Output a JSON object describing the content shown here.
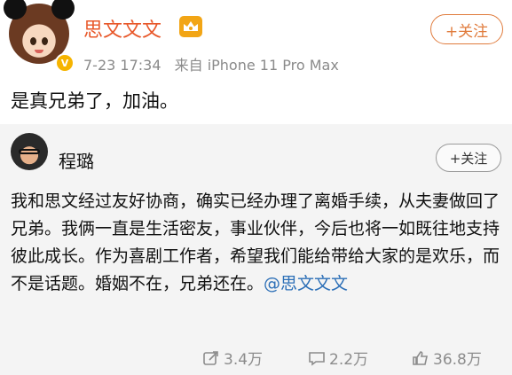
{
  "post": {
    "author": "思文文文",
    "timestamp": "7-23 17:34",
    "source": "来自 iPhone 11 Pro Max",
    "follow_label": "+关注",
    "text": "是真兄弟了，加油。"
  },
  "repost": {
    "author": "程璐",
    "follow_label": "+关注",
    "text": "我和思文经过友好协商，确实已经办理了离婚手续，从夫妻做回了兄弟。我俩一直是生活密友，事业伙伴，今后也将一如既往地支持彼此成长。作为喜剧工作者，希望我们能给带给大家的是欢乐，而不是话题。婚姻不在，兄弟还在。",
    "mention": "@思文文文",
    "actions": {
      "repost_count": "3.4万",
      "comment_count": "2.2万",
      "like_count": "36.8万"
    }
  },
  "icons": {
    "verified": "v-badge-icon",
    "vip": "crown-icon",
    "repost": "repost-icon",
    "comment": "comment-icon",
    "like": "thumbs-up-icon"
  },
  "colors": {
    "author_name": "#e8582a",
    "follow_border": "#e07b3c",
    "mention": "#2c6fb7",
    "meta_gray": "#8a8a8a",
    "repost_bg": "#f4f4f4"
  }
}
